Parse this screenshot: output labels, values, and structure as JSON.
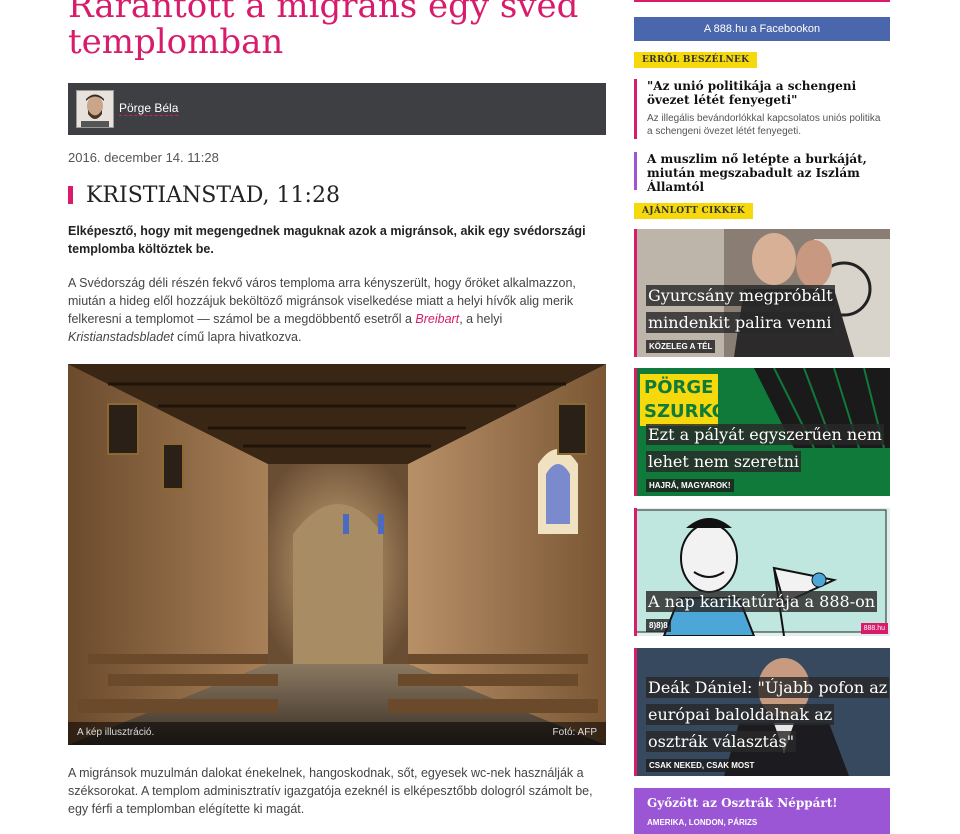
{
  "article": {
    "title": "Rárántott a migráns egy svéd templomban",
    "author": "Pörge Béla",
    "date": "2016. december 14. 11:28",
    "dateline": "KRISTIANSTAD, 11:28",
    "lead": "Elképesztő, hogy mit megengednek maguknak azok a migránsok, akik egy svédországi templomba költöztek be.",
    "body1_part1": "A Svédország déli részén fekvő város temploma arra kényszerült, hogy őröket alkalmazzon, miután a hideg elől hozzájuk beköltöző migránsok viselkedése miatt a helyi hívők alig merik felkeresni a templomot — számol be a megdöbbentő esetről a ",
    "body1_link": "Breibart",
    "body1_part2": ", a helyi ",
    "body1_em": "Kristianstadsbladet",
    "body1_part3": " című lapra hivatkozva.",
    "photo_caption": "A kép illusztráció.",
    "photo_credit": "Fotó: AFP",
    "body2": "A migránsok muzulmán dalokat énekelnek, hangoskodnak, sőt, egyesek wc-nek használják a széksorokat. A templom adminisztratív igazgatója ezeknél is elképesztőbb dologról számolt be, egy férfi a templomban elégítette ki magát."
  },
  "sidebar": {
    "facebook_label": "A 888.hu a Facebookon",
    "talk_tag": "Erről beszélnek",
    "talk_items": [
      {
        "title": "\"Az unió politikája a schengeni övezet létét fenyegeti\"",
        "desc": "Az illegális bevándorlókkal kapcsolatos uniós politika a schengeni övezet létét fenyegeti."
      },
      {
        "title": "A muszlim nő letépte a burkáját, miután megszabadult az Iszlám Államtól",
        "desc": ""
      }
    ],
    "recommended_tag": "Ajánlott cikkek",
    "cards": [
      {
        "title_lines": [
          "Gyurcsány megpróbált",
          "mindenkit palira venni"
        ],
        "sub": "Közeleg a tél"
      },
      {
        "title_lines": [
          "Ezt a pályát egyszerűen nem",
          "lehet nem szeretni"
        ],
        "sub": "Hajrá, magyarok!",
        "logo_top": "PÖRGE",
        "logo_bottom": "SZURKOL"
      },
      {
        "title_lines": [
          "A nap karikatúrája a 888-on"
        ],
        "sub": "8)8)8",
        "badge": "888.hu"
      },
      {
        "title_lines": [
          "Deák Dániel: \"Újabb pofon az",
          "európai baloldalnak az",
          "osztrák választás\""
        ],
        "sub": "Csak neked, csak most"
      }
    ],
    "bottom": {
      "title": "Győzött az Osztrák Néppárt!",
      "sub": "Amerika, London, Párizs"
    }
  },
  "colors": {
    "accent": "#d81b6b",
    "facebook": "#4a67ad",
    "tag": "#f5d90c",
    "purple": "#9b56d6"
  }
}
